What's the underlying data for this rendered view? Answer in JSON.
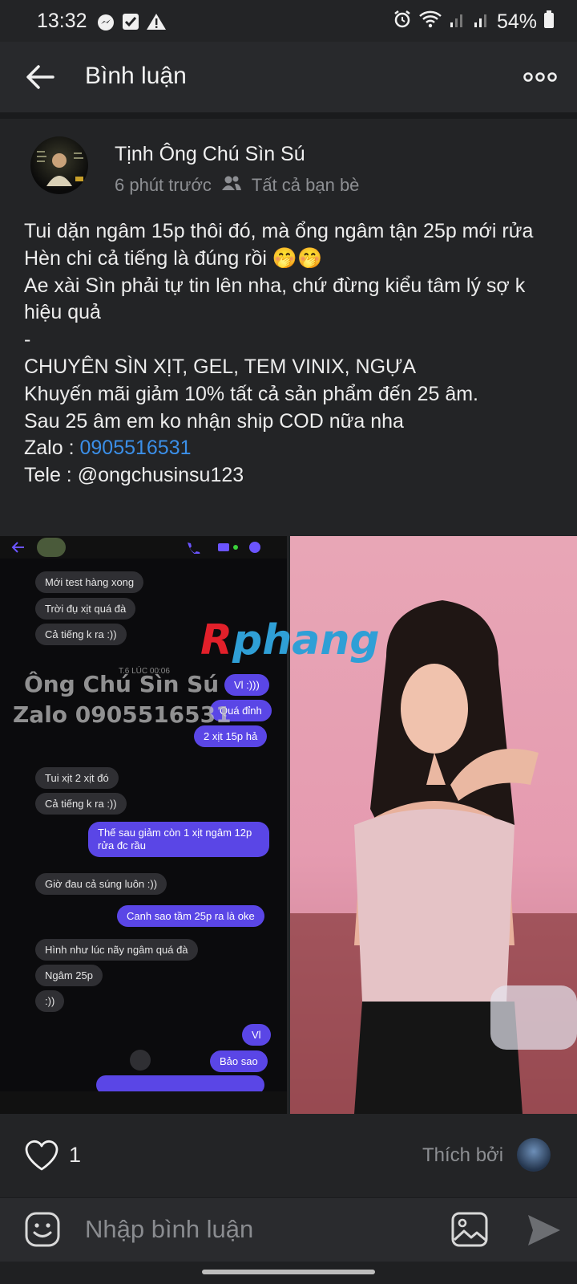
{
  "status_bar": {
    "time": "13:32",
    "battery": "54%",
    "icons": [
      "messenger-icon",
      "check-square-icon",
      "warning-icon",
      "alarm-icon",
      "wifi-icon",
      "signal-icon",
      "signal-icon",
      "battery-icon"
    ]
  },
  "header": {
    "title": "Bình luận"
  },
  "post": {
    "author": "Tịnh Ông Chú Sìn Sú",
    "time": "6 phút trước",
    "audience": "Tất cả bạn bè",
    "text_before_link": "Tui dặn ngâm 15p thôi đó, mà ổng ngâm tận 25p mới rửa\nHèn chi cả tiếng là đúng rồi 🤭🤭\nAe xài Sìn phải tự tin lên nha, chứ đừng kiểu tâm lý sợ k hiệu quả\n-\nCHUYÊN SÌN XỊT, GEL, TEM VINIX, NGỰA\nKhuyến mãi giảm 10% tất cả sản phẩm đến 25 âm.\nSau 25 âm em ko nhận ship COD nữa nha\nZalo : ",
    "phone_link": "0905516531",
    "text_after_link": "\nTele : @ongchusinsu123"
  },
  "chat_image": {
    "date": "T.6 LÚC 00:06",
    "messages": [
      {
        "dir": "in",
        "text": "Mới test hàng xong"
      },
      {
        "dir": "in",
        "text": "Trời đụ xịt quá đà"
      },
      {
        "dir": "in",
        "text": "Cả tiếng k ra :))"
      },
      {
        "dir": "out",
        "text": "Vl :)))"
      },
      {
        "dir": "out",
        "text": "Quá đỉnh"
      },
      {
        "dir": "out",
        "text": "2 xịt 15p hả"
      },
      {
        "dir": "in",
        "text": "Tui xịt 2 xịt đó"
      },
      {
        "dir": "in",
        "text": "Cả tiếng k ra :))"
      },
      {
        "dir": "out",
        "text": "Thế sau giảm còn 1 xịt ngâm 12p"
      },
      {
        "dir": "out",
        "text": "rửa đc rầu"
      },
      {
        "dir": "in",
        "text": "Giờ đau cả súng luôn :))"
      },
      {
        "dir": "out",
        "text": "Canh sao tầm 25p ra là oke"
      },
      {
        "dir": "in",
        "text": "Hình như lúc nãy ngâm quá đà"
      },
      {
        "dir": "in",
        "text": "Ngâm 25p"
      },
      {
        "dir": "in",
        "text": ":))"
      },
      {
        "dir": "out",
        "text": "Vl"
      },
      {
        "dir": "out",
        "text": "Bảo sao"
      }
    ],
    "watermark_line1": "Ông Chú Sìn Sú",
    "watermark_line2": "Zalo 0905516531",
    "logo_r": "R",
    "logo_rest": "phang"
  },
  "reactions": {
    "like_count": "1",
    "liked_by_label": "Thích bởi"
  },
  "comment": {
    "placeholder": "Nhập bình luận"
  },
  "colors": {
    "background": "#232426",
    "link": "#3b8fe8",
    "outgoing_bubble": "#5a46e6"
  }
}
